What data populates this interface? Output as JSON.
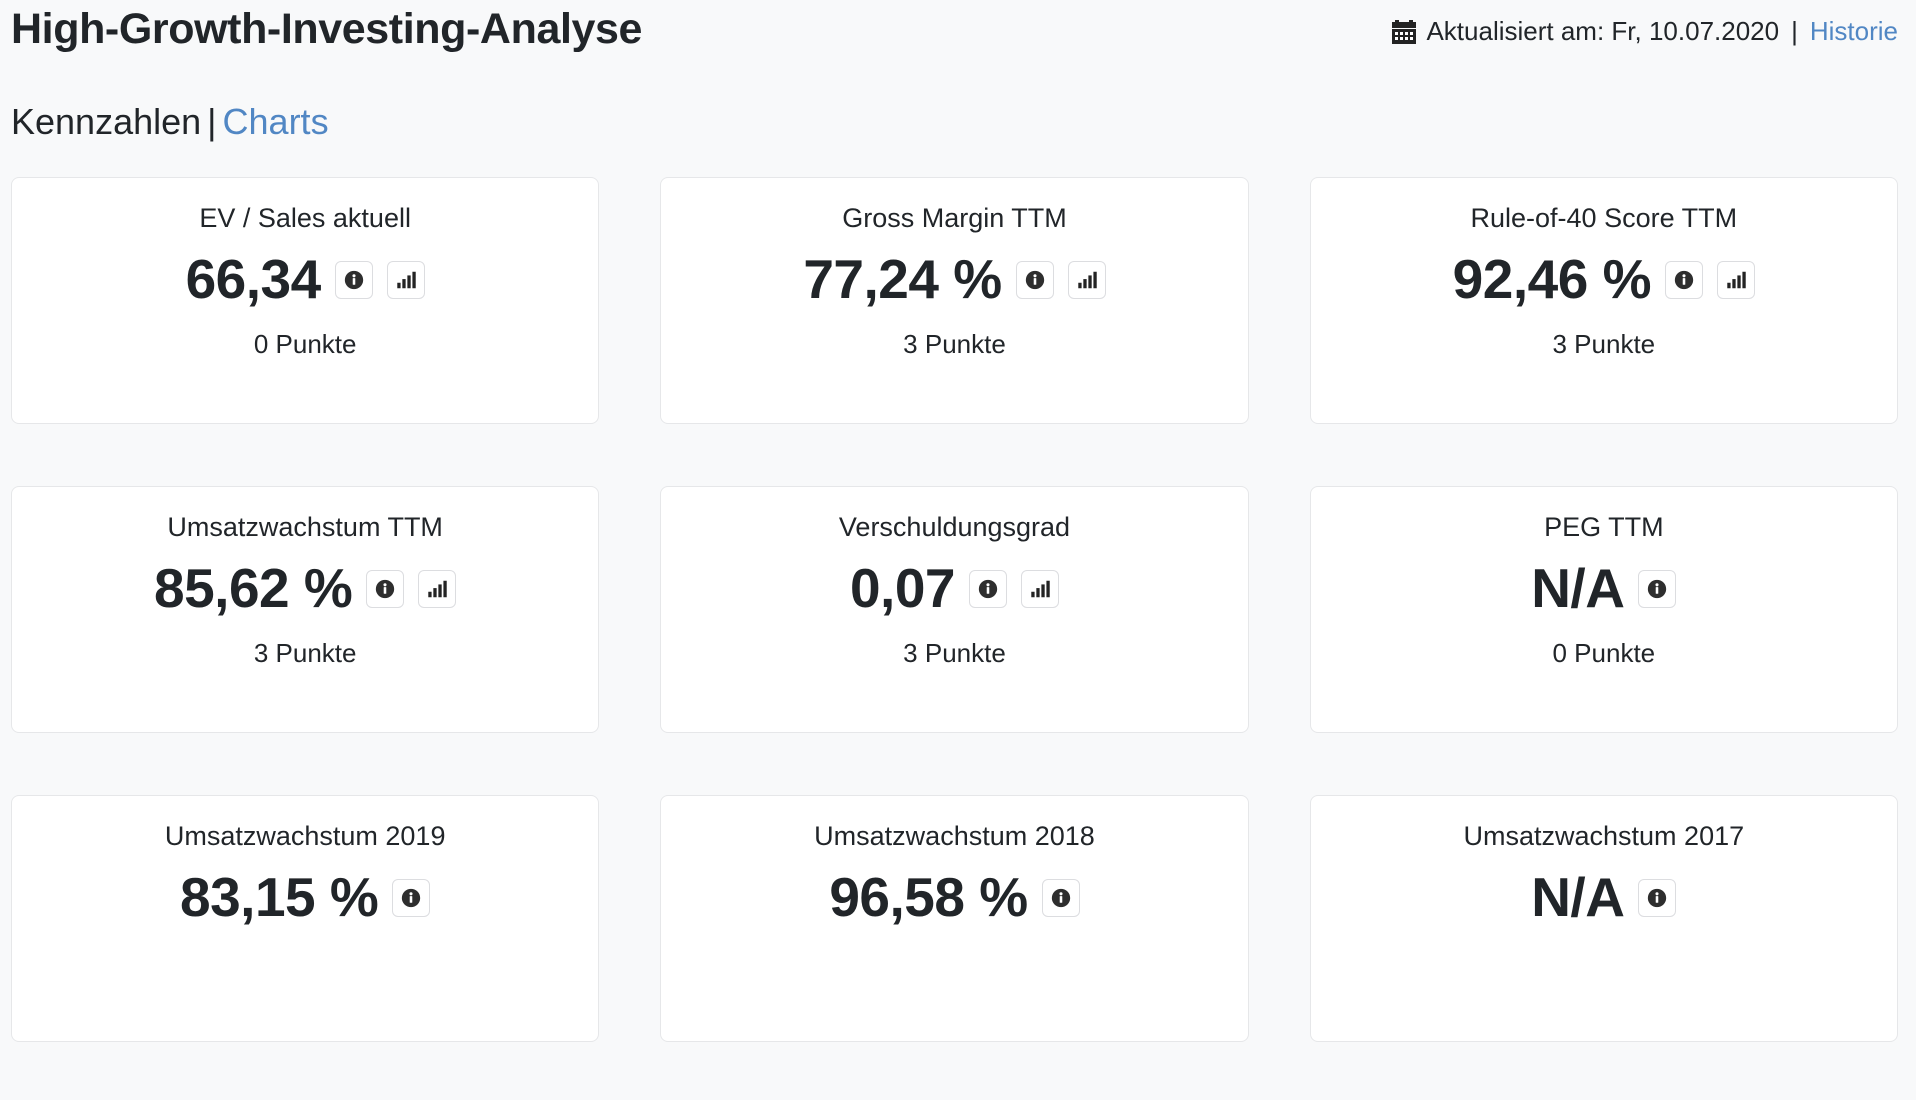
{
  "header": {
    "title": "High-Growth-Investing-Analyse",
    "calendar_icon": "calendar-icon",
    "updated_label": "Aktualisiert am: Fr, 10.07.2020",
    "separator": "|",
    "history_link": "Historie"
  },
  "subnav": {
    "kennzahlen_label": "Kennzahlen",
    "separator": "|",
    "charts_label": "Charts",
    "active": "Charts"
  },
  "colors": {
    "page_background": "#f8f9fa",
    "card_background": "#ffffff",
    "card_border": "#e6e7e9",
    "text": "#212529",
    "link": "#5187c4",
    "icon_dark": "#2e2e2e"
  },
  "icons": {
    "info": "info-circle-icon",
    "chart": "bar-chart-icon"
  },
  "cards": [
    {
      "title": "EV / Sales aktuell",
      "value": "66,34",
      "points": "0 Punkte",
      "has_info": true,
      "has_chart": true,
      "has_points": true
    },
    {
      "title": "Gross Margin TTM",
      "value": "77,24 %",
      "points": "3 Punkte",
      "has_info": true,
      "has_chart": true,
      "has_points": true
    },
    {
      "title": "Rule-of-40 Score TTM",
      "value": "92,46 %",
      "points": "3 Punkte",
      "has_info": true,
      "has_chart": true,
      "has_points": true
    },
    {
      "title": "Umsatzwachstum TTM",
      "value": "85,62 %",
      "points": "3 Punkte",
      "has_info": true,
      "has_chart": true,
      "has_points": true
    },
    {
      "title": "Verschuldungsgrad",
      "value": "0,07",
      "points": "3 Punkte",
      "has_info": true,
      "has_chart": true,
      "has_points": true
    },
    {
      "title": "PEG TTM",
      "value": "N/A",
      "points": "0 Punkte",
      "has_info": true,
      "has_chart": false,
      "has_points": true
    },
    {
      "title": "Umsatzwachstum 2019",
      "value": "83,15 %",
      "points": "",
      "has_info": true,
      "has_chart": false,
      "has_points": false
    },
    {
      "title": "Umsatzwachstum 2018",
      "value": "96,58 %",
      "points": "",
      "has_info": true,
      "has_chart": false,
      "has_points": false
    },
    {
      "title": "Umsatzwachstum 2017",
      "value": "N/A",
      "points": "",
      "has_info": true,
      "has_chart": false,
      "has_points": false
    }
  ]
}
